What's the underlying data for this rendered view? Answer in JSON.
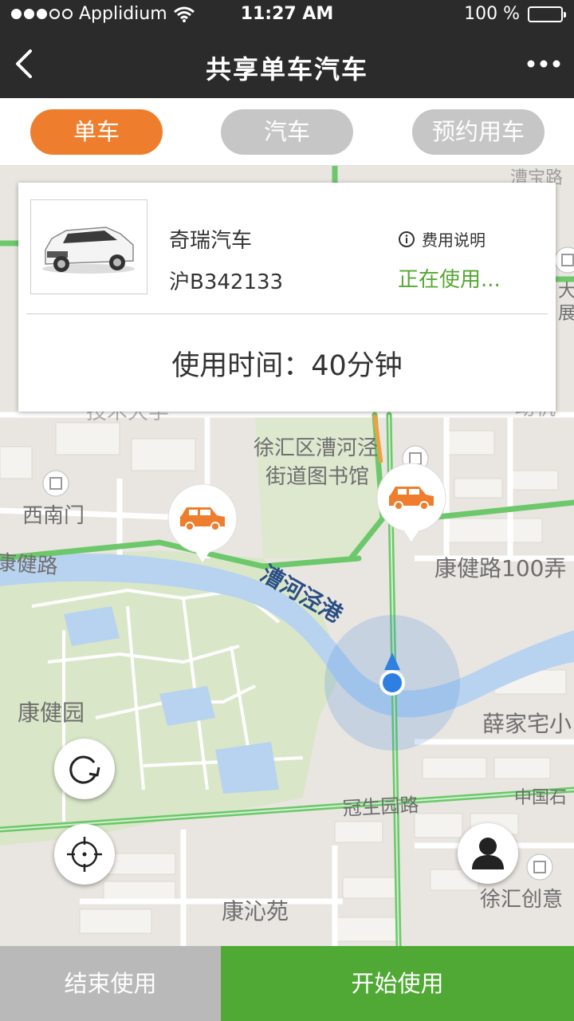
{
  "status_bar": {
    "carrier": "Applidium",
    "time": "11:27 AM",
    "battery": "100 %",
    "signal_icon": "signal-dots-icon",
    "wifi_icon": "wifi-icon",
    "battery_icon": "battery-icon"
  },
  "header": {
    "title": "共享单车汽车",
    "back_icon": "chevron-left-icon",
    "more_icon": "more-dots-icon"
  },
  "tabs": [
    {
      "label": "单车",
      "active": true
    },
    {
      "label": "汽车",
      "active": false
    },
    {
      "label": "预约用车",
      "active": false
    }
  ],
  "vehicle_card": {
    "name": "奇瑞汽车",
    "plate": "沪B342133",
    "fee_label": "费用说明",
    "status": "正在使用...",
    "usage_label": "使用时间：40分钟"
  },
  "map": {
    "labels": {
      "district_library": [
        "徐汇区漕河泾",
        "街道图书馆"
      ],
      "southwest_gate": "西南门",
      "kangjian_road_left": "康健路",
      "kangjian_road_right": "康健路100弄",
      "caohejing_river": "漕河泾港",
      "kangjian_park": "康健园",
      "xuejiazhai": "薛家宅小",
      "guansheng_road": "冠生园路",
      "china_right": "中国石",
      "kangqin_garden": "康沁苑",
      "xuhui_creative": "徐汇创意",
      "top_partial_left": "技术大学",
      "top_partial_right": "动机",
      "top_road_partial": "漕宝路",
      "museum_partial": [
        "大国",
        "展厅"
      ]
    },
    "car_markers": [
      "car-marker-left",
      "car-marker-right"
    ],
    "colors": {
      "road_green": "#6cc86a",
      "park": "#d9e6c8",
      "river": "#b8d3ef",
      "user_dot": "#2f7fe0",
      "car_orange": "#ee7e2d"
    }
  },
  "controls": {
    "refresh_icon": "refresh-icon",
    "locate_icon": "crosshair-icon",
    "user_icon": "user-icon"
  },
  "actions": {
    "end": "结束使用",
    "start": "开始使用"
  }
}
